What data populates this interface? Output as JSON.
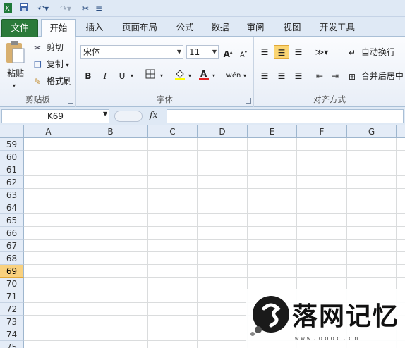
{
  "tabs": [
    "文件",
    "开始",
    "插入",
    "页面布局",
    "公式",
    "数据",
    "审阅",
    "视图",
    "开发工具"
  ],
  "clipboard": {
    "paste": "粘贴",
    "cut": "剪切",
    "copy": "复制",
    "format_painter": "格式刷",
    "label": "剪贴板"
  },
  "font": {
    "name": "宋体",
    "size": "11",
    "bold": "B",
    "italic": "I",
    "underline": "U",
    "label": "字体"
  },
  "alignment": {
    "wrap": "自动换行",
    "merge": "合并后居中",
    "label": "对齐方式"
  },
  "formula_bar": {
    "name_box": "K69",
    "fx": "fx"
  },
  "columns": [
    "A",
    "B",
    "C",
    "D",
    "E",
    "F",
    "G"
  ],
  "rows": [
    "59",
    "60",
    "61",
    "62",
    "63",
    "64",
    "65",
    "66",
    "67",
    "68",
    "69",
    "70",
    "71",
    "72",
    "73",
    "74",
    "75"
  ],
  "selected_row": "69",
  "watermark": {
    "text": "落网记忆",
    "url": "www.oooc.cn"
  },
  "colors": {
    "file_tab": "#2b7a3a",
    "selected_row": "#f9d17e",
    "ribbon_bg": "#dfe9f5"
  }
}
